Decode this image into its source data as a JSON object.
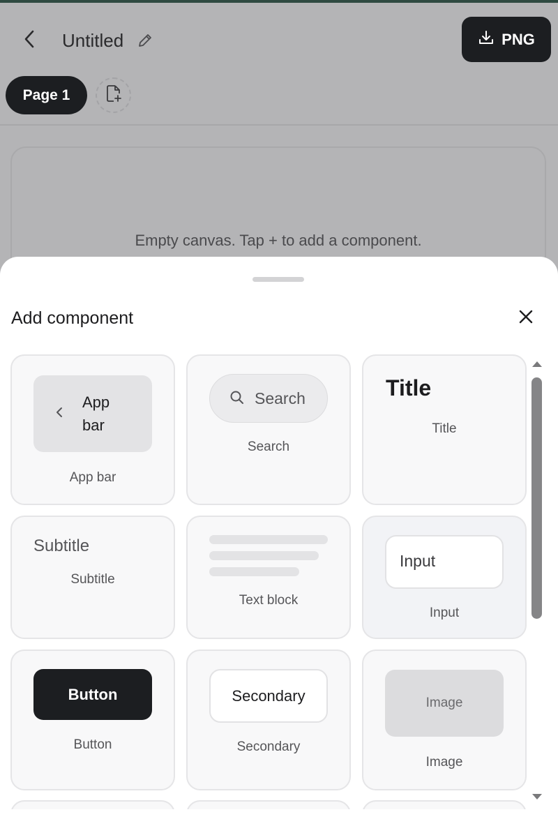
{
  "header": {
    "back_icon": "chevron-left-icon",
    "title": "Untitled",
    "edit_icon": "pencil-icon",
    "export_icon": "download-icon",
    "export_label": "PNG"
  },
  "pages": {
    "tabs": [
      {
        "label": "Page 1",
        "active": true
      }
    ],
    "add_page_icon": "add-page-icon"
  },
  "canvas": {
    "empty_message": "Empty canvas. Tap + to add a component."
  },
  "sheet": {
    "title": "Add component",
    "close_icon": "close-icon",
    "components": [
      {
        "id": "app-bar",
        "label": "App bar",
        "preview": "App bar"
      },
      {
        "id": "search",
        "label": "Search",
        "preview": "Search"
      },
      {
        "id": "title",
        "label": "Title",
        "preview": "Title"
      },
      {
        "id": "subtitle",
        "label": "Subtitle",
        "preview": "Subtitle"
      },
      {
        "id": "text-block",
        "label": "Text block",
        "preview": ""
      },
      {
        "id": "input",
        "label": "Input",
        "preview": "Input"
      },
      {
        "id": "button",
        "label": "Button",
        "preview": "Button"
      },
      {
        "id": "secondary",
        "label": "Secondary",
        "preview": "Secondary"
      },
      {
        "id": "image",
        "label": "Image",
        "preview": "Image"
      }
    ]
  },
  "colors": {
    "dark": "#1c1e21",
    "overlay": "#b4b4b6",
    "sheet": "#ffffff",
    "card": "#f8f8f9",
    "top_accent": "#2f4a41"
  }
}
